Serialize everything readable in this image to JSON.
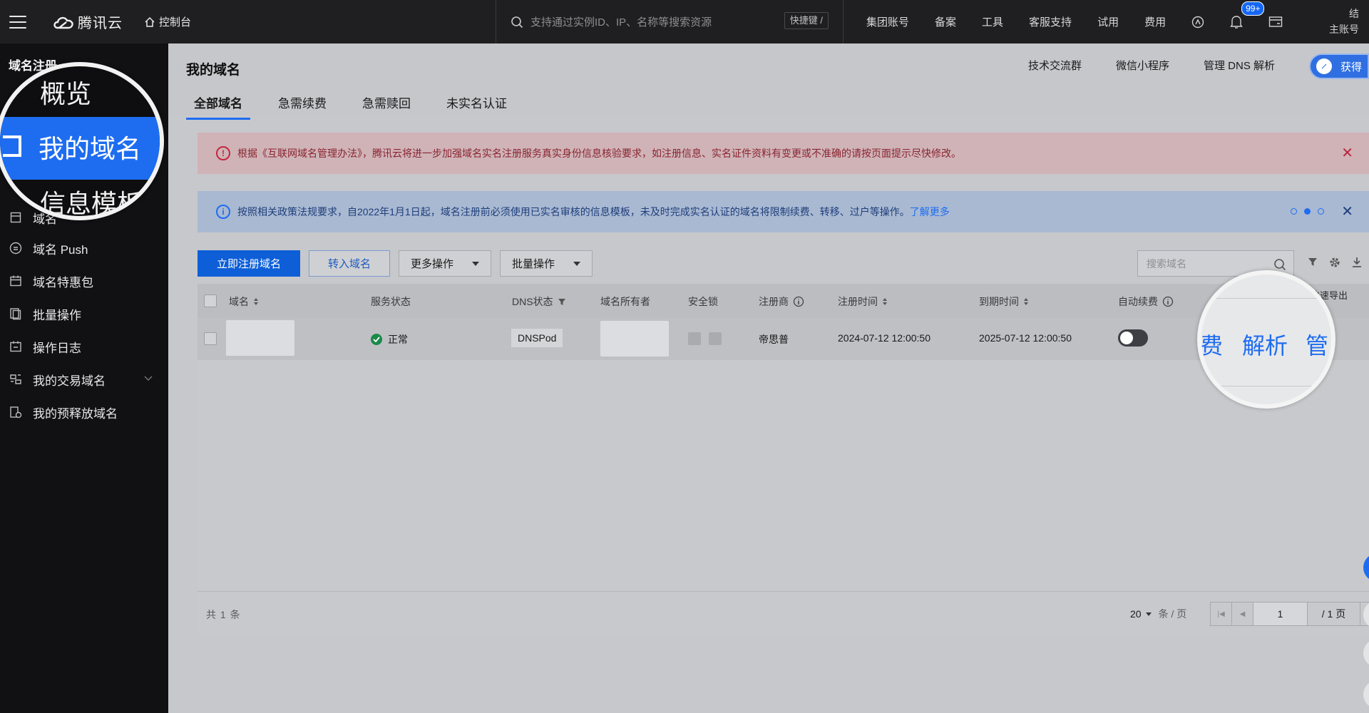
{
  "topbar": {
    "brand": "腾讯云",
    "console": "控制台",
    "search_placeholder": "支持通过实例ID、IP、名称等搜索资源",
    "shortcut": "快捷键 /",
    "nav": [
      "集团账号",
      "备案",
      "工具",
      "客服支持",
      "试用",
      "费用"
    ],
    "badge": "99+",
    "account_line1": "结",
    "account_line2": "主账号"
  },
  "sidebar": {
    "title": "域名注册",
    "items": [
      {
        "label": "域名 Push",
        "icon": "push-icon"
      },
      {
        "label": "域名特惠包",
        "icon": "calendar-icon"
      },
      {
        "label": "批量操作",
        "icon": "copy-icon"
      },
      {
        "label": "操作日志",
        "icon": "log-icon"
      },
      {
        "label": "我的交易域名",
        "icon": "trade-icon"
      },
      {
        "label": "我的预释放域名",
        "icon": "release-icon"
      }
    ],
    "partial_item": "域名",
    "magnifier": {
      "overview": "概览",
      "my_domains": "我的域名",
      "templates": "信息模板"
    }
  },
  "page": {
    "title": "我的域名",
    "head_links": [
      "技术交流群",
      "微信小程序",
      "管理 DNS 解析"
    ],
    "get_button": "获得",
    "tabs": [
      "全部域名",
      "急需续费",
      "急需赎回",
      "未实名认证"
    ],
    "active_tab": 0
  },
  "alerts": {
    "red": "根据《互联网域名管理办法》，腾讯云将进一步加强域名实名注册服务真实身份信息核验要求，如注册信息、实名证件资料有变更或不准确的请按页面提示尽快修改。",
    "blue": "按照相关政策法规要求，自2022年1月1日起，域名注册前必须使用已实名审核的信息模板，未及时完成实名认证的域名将限制续费、转移、过户等操作。",
    "blue_link": "了解更多"
  },
  "toolbar": {
    "register": "立即注册域名",
    "transfer": "转入域名",
    "more": "更多操作",
    "batch": "批量操作",
    "search_placeholder": "搜索域名"
  },
  "table": {
    "headers": [
      "域名",
      "服务状态",
      "DNS状态",
      "域名所有者",
      "安全锁",
      "注册商",
      "注册时间",
      "到期时间",
      "自动续费"
    ],
    "row": {
      "status": "正常",
      "dns": "DNSPod",
      "registrar": "帝思普",
      "registered": "2024-07-12 12:00:50",
      "expires": "2025-07-12 12:00:50",
      "auto_renew": false
    },
    "total": "共 1 条",
    "page_size": "20",
    "page_size_unit": "条 / 页",
    "current_page": "1",
    "total_pages": "/ 1 页"
  },
  "magnifier_right": {
    "actions": [
      "费",
      "解析",
      "管"
    ],
    "export_tip": "快速导出"
  }
}
